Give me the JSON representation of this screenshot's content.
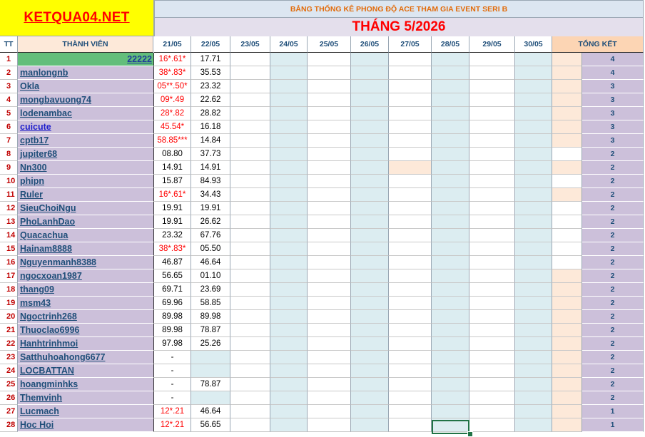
{
  "header": {
    "logo_text": "KETQUA04.NET",
    "subtitle": "BẢNG THỐNG KÊ PHONG ĐỘ ACE THAM GIA EVENT SERI B",
    "month_title": "THÁNG 5/2026"
  },
  "columns": {
    "tt": "TT",
    "member": "THÀNH VIÊN",
    "dates": [
      "21/05",
      "22/05",
      "23/05",
      "24/05",
      "25/05",
      "26/05",
      "27/05",
      "28/05",
      "29/05",
      "30/05"
    ],
    "summary": "TỔNG KẾT"
  },
  "rows": [
    {
      "tt": "1",
      "name": "22222",
      "d21": "16*.61*",
      "d22": "17.71",
      "total": "4"
    },
    {
      "tt": "2",
      "name": "manlongnb",
      "d21": "38*.83*",
      "d22": "35.53",
      "total": "4"
    },
    {
      "tt": "3",
      "name": "Okla",
      "d21": "05**.50*",
      "d22": "23.32",
      "total": "3"
    },
    {
      "tt": "4",
      "name": "mongbavuong74",
      "d21": "09*.49",
      "d22": "22.62",
      "total": "3"
    },
    {
      "tt": "5",
      "name": "lodenambac",
      "d21": "28*.82",
      "d22": "28.82",
      "total": "3"
    },
    {
      "tt": "6",
      "name": "cuicute",
      "d21": "45.54*",
      "d22": "16.18",
      "total": "3"
    },
    {
      "tt": "7",
      "name": "cptb17",
      "d21": "58.85***",
      "d22": "14.84",
      "total": "3"
    },
    {
      "tt": "8",
      "name": "jupiter68",
      "d21": "08.80",
      "d22": "37.73",
      "total": "2"
    },
    {
      "tt": "9",
      "name": "Nn300",
      "d21": "14.91",
      "d22": "14.91",
      "total": "2"
    },
    {
      "tt": "10",
      "name": "phipn",
      "d21": "15.87",
      "d22": "84.93",
      "total": "2"
    },
    {
      "tt": "11",
      "name": "Ruler",
      "d21": "16*.61*",
      "d22": "34.43",
      "total": "2"
    },
    {
      "tt": "12",
      "name": "SieuChoiNgu",
      "d21": "19.91",
      "d22": "19.91",
      "total": "2"
    },
    {
      "tt": "13",
      "name": "PhoLanhDao",
      "d21": "19.91",
      "d22": "26.62",
      "total": "2"
    },
    {
      "tt": "14",
      "name": "Quacachua",
      "d21": "23.32",
      "d22": "67.76",
      "total": "2"
    },
    {
      "tt": "15",
      "name": "Hainam8888",
      "d21": "38*.83*",
      "d22": "05.50",
      "total": "2"
    },
    {
      "tt": "16",
      "name": "Nguyenmanh8388",
      "d21": "46.87",
      "d22": "46.64",
      "total": "2"
    },
    {
      "tt": "17",
      "name": "ngocxoan1987",
      "d21": "56.65",
      "d22": "01.10",
      "total": "2"
    },
    {
      "tt": "18",
      "name": "thang09",
      "d21": "69.71",
      "d22": "23.69",
      "total": "2"
    },
    {
      "tt": "19",
      "name": "msm43",
      "d21": "69.96",
      "d22": "58.85",
      "total": "2"
    },
    {
      "tt": "20",
      "name": "Ngoctrinh268",
      "d21": "89.98",
      "d22": "89.98",
      "total": "2"
    },
    {
      "tt": "21",
      "name": "Thuoclao6996",
      "d21": "89.98",
      "d22": "78.87",
      "total": "2"
    },
    {
      "tt": "22",
      "name": "Hanhtrinhmoi",
      "d21": "97.98",
      "d22": "25.26",
      "total": "2"
    },
    {
      "tt": "23",
      "name": "Satthuhoahong6677",
      "d21": "-",
      "d22": "",
      "total": "2"
    },
    {
      "tt": "24",
      "name": "LOCBATTAN",
      "d21": "-",
      "d22": "",
      "total": "2"
    },
    {
      "tt": "25",
      "name": "hoangminhks",
      "d21": "-",
      "d22": "78.87",
      "total": "2"
    },
    {
      "tt": "26",
      "name": "Themvinh",
      "d21": "-",
      "d22": "",
      "total": "2"
    },
    {
      "tt": "27",
      "name": "Lucmach",
      "d21": "12*.21",
      "d22": "46.64",
      "total": "1"
    },
    {
      "tt": "28",
      "name": "Hoc Hoi",
      "d21": "12*.21",
      "d22": "56.65",
      "total": "1"
    }
  ],
  "colors": {
    "logo_bg": "#ffff00",
    "logo_text": "#ff0000",
    "name_bg": "#ccc0da",
    "first_row_bg": "#63be7b",
    "peach": "#fde9d9",
    "light_blue": "#dcedf1",
    "red_value": "#ff0000",
    "link": "#1f4e79"
  }
}
